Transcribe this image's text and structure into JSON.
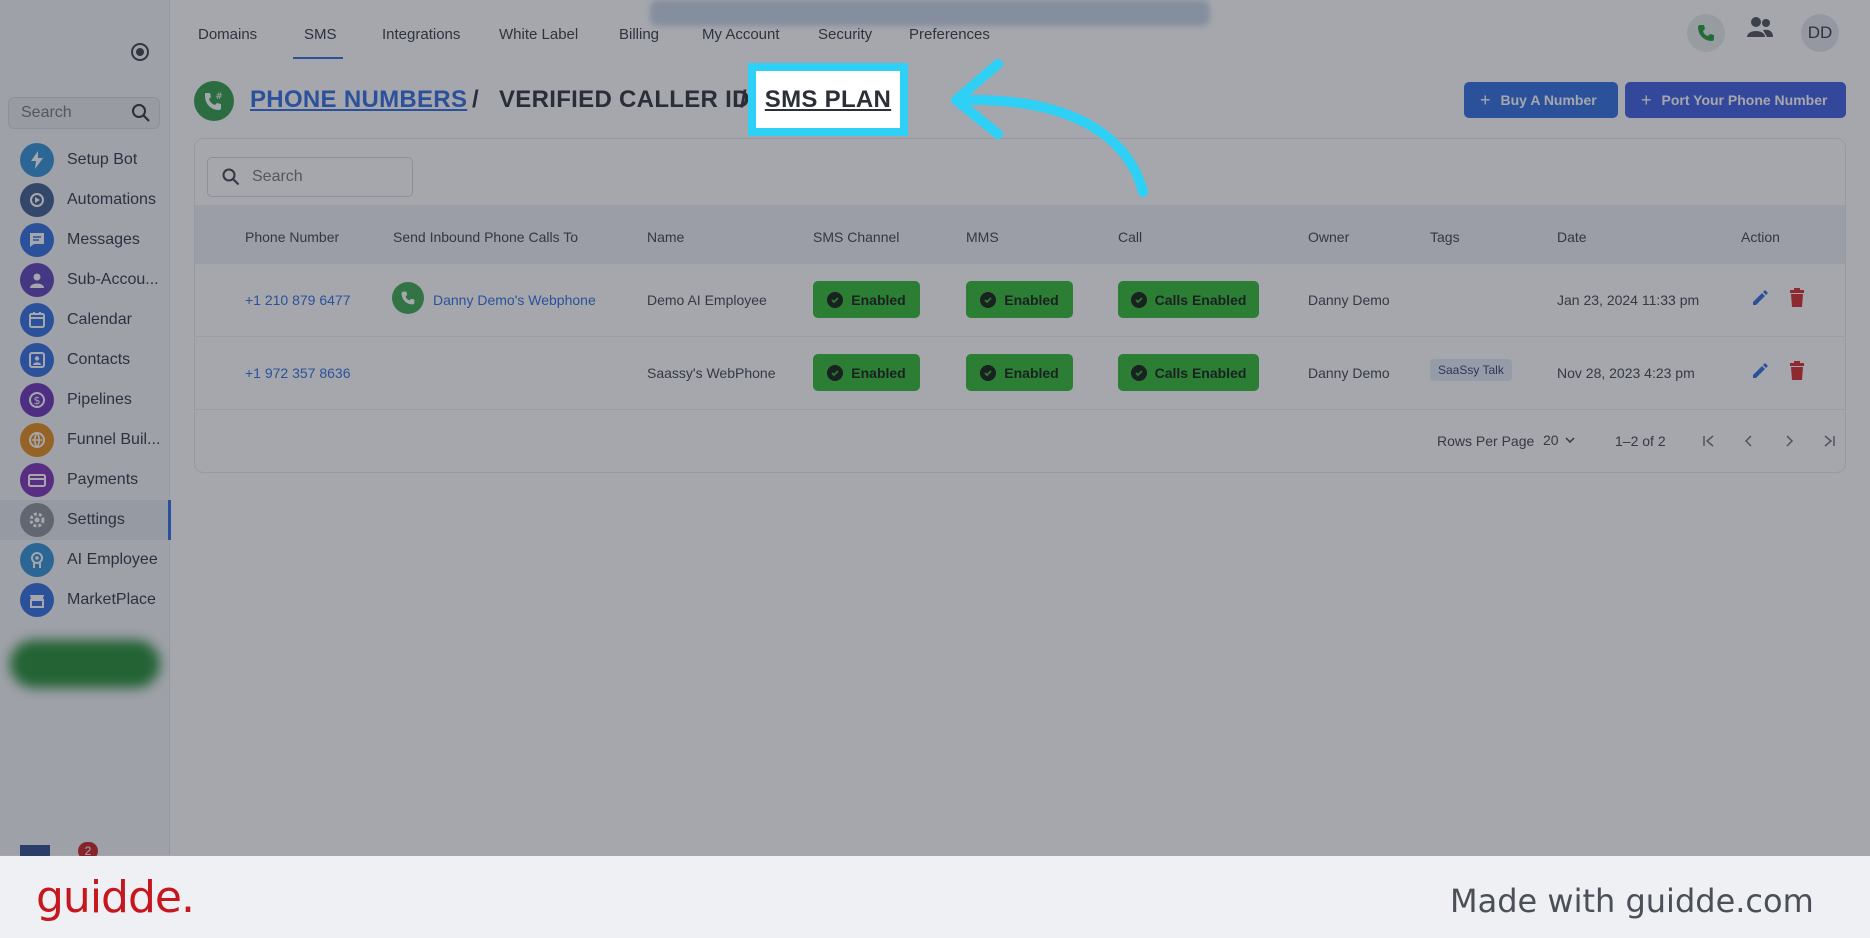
{
  "sidebar": {
    "search_placeholder": "Search",
    "items": [
      {
        "label": "Setup Bot",
        "icon": "bolt-icon",
        "color": "#2d8fd5"
      },
      {
        "label": "Automations",
        "icon": "automation-icon",
        "color": "#3b5b8c"
      },
      {
        "label": "Messages",
        "icon": "chat-icon",
        "color": "#2d6cdf"
      },
      {
        "label": "Sub-Accou...",
        "icon": "user-icon",
        "color": "#5b3fb5"
      },
      {
        "label": "Calendar",
        "icon": "calendar-icon",
        "color": "#2d6cdf"
      },
      {
        "label": "Contacts",
        "icon": "contacts-icon",
        "color": "#2d6cdf"
      },
      {
        "label": "Pipelines",
        "icon": "dollar-icon",
        "color": "#6a2fb5"
      },
      {
        "label": "Funnel Buil...",
        "icon": "funnel-icon",
        "color": "#e58a17"
      },
      {
        "label": "Payments",
        "icon": "card-icon",
        "color": "#7a2db5"
      },
      {
        "label": "Settings",
        "icon": "gear-icon",
        "color": "#8a8f98"
      },
      {
        "label": "AI Employee",
        "icon": "ai-icon",
        "color": "#2d8fd5"
      },
      {
        "label": "MarketPlace",
        "icon": "store-icon",
        "color": "#2d6cdf"
      }
    ],
    "notification_count": "2"
  },
  "topnav": {
    "tabs": [
      "Domains",
      "SMS",
      "Integrations",
      "White Label",
      "Billing",
      "My Account",
      "Security",
      "Preferences"
    ],
    "active_tab": "SMS",
    "avatar_initials": "DD"
  },
  "heading": {
    "crumb_phone_numbers": "PHONE NUMBERS",
    "separator": "/",
    "crumb_verified_caller_id": "VERIFIED CALLER ID",
    "crumb_sms_plan": "SMS PLAN"
  },
  "buttons": {
    "buy_number": "Buy A Number",
    "port_number": "Port Your Phone Number"
  },
  "table": {
    "search_placeholder": "Search",
    "columns": [
      "Phone Number",
      "Send Inbound Phone Calls To",
      "Name",
      "SMS Channel",
      "MMS",
      "Call",
      "Owner",
      "Tags",
      "Date",
      "Action"
    ],
    "rows": [
      {
        "phone": "+1 210 879 6477",
        "inbound": "Danny Demo's Webphone",
        "name": "Demo AI Employee",
        "sms": "Enabled",
        "mms": "Enabled",
        "call": "Calls Enabled",
        "owner": "Danny Demo",
        "tag": "",
        "date": "Jan 23, 2024 11:33 pm"
      },
      {
        "phone": "+1 972 357 8636",
        "inbound": "",
        "name": "Saassy's WebPhone",
        "sms": "Enabled",
        "mms": "Enabled",
        "call": "Calls Enabled",
        "owner": "Danny Demo",
        "tag": "SaaSsy Talk",
        "date": "Nov 28, 2023 4:23 pm"
      }
    ],
    "pagination": {
      "rows_per_page_label": "Rows Per Page",
      "rows_per_page": "20",
      "range": "1–2 of 2"
    }
  },
  "footer": {
    "logo": "guidde.",
    "made_with": "Made with guidde.com"
  },
  "colors": {
    "accent": "#2d6cdf",
    "highlight": "#2fd0f5",
    "enabled_green": "#2fb82f",
    "delete_red": "#d6282a",
    "brand_red": "#c6171e"
  }
}
